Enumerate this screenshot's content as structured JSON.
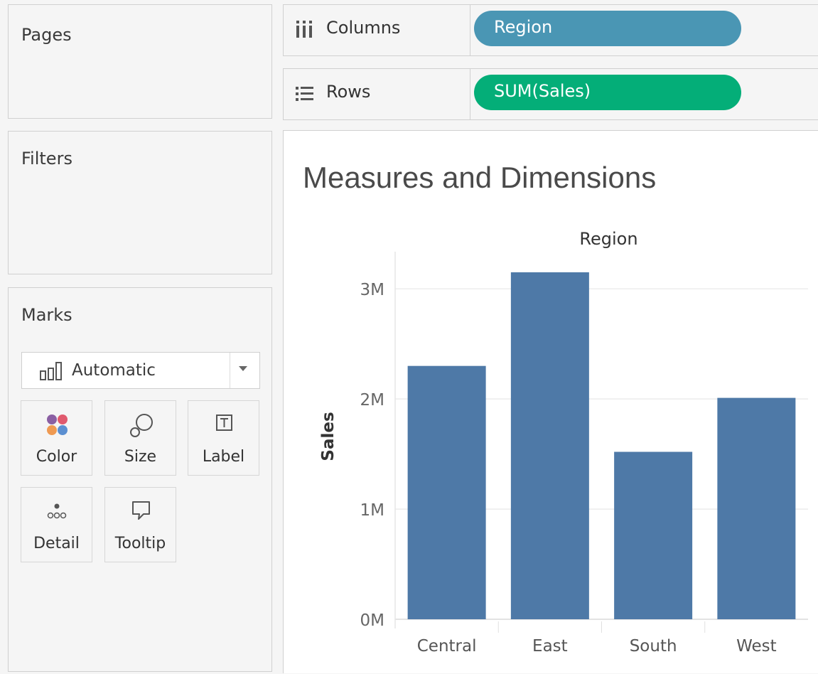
{
  "pages": {
    "title": "Pages"
  },
  "filters": {
    "title": "Filters"
  },
  "marks": {
    "title": "Marks",
    "mark_type": "Automatic",
    "buttons": {
      "color": "Color",
      "size": "Size",
      "label": "Label",
      "detail": "Detail",
      "tooltip": "Tooltip"
    }
  },
  "shelves": {
    "columns": {
      "label": "Columns",
      "pill": "Region",
      "pill_color": "#4a96b4"
    },
    "rows": {
      "label": "Rows",
      "pill": "SUM(Sales)",
      "pill_color": "#04ae78"
    }
  },
  "view": {
    "title": "Measures and Dimensions"
  },
  "chart_data": {
    "type": "bar",
    "header": "Region",
    "ylabel": "Sales",
    "categories": [
      "Central",
      "East",
      "South",
      "West"
    ],
    "values": [
      2300000,
      3150000,
      1520000,
      2010000
    ],
    "ylim": [
      0,
      3300000
    ],
    "yticks": [
      0,
      1000000,
      2000000,
      3000000
    ],
    "ytick_labels": [
      "0M",
      "1M",
      "2M",
      "3M"
    ],
    "bar_color": "#4e79a7",
    "grid": true
  }
}
